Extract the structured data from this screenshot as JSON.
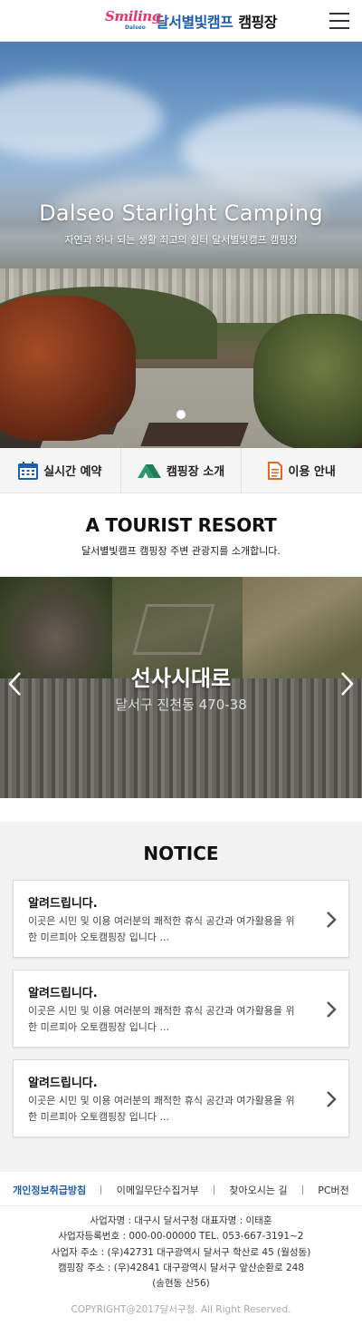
{
  "header": {
    "logo_smiling": "Smiling",
    "logo_dalseo": "Dalseo",
    "logo_main": "달서별빛캠프",
    "logo_sub": "캠핑장",
    "menu_icon": "hamburger-menu-icon"
  },
  "hero": {
    "title": "Dalseo Starlight Camping",
    "subtitle": "자연과 하나 되는 생활 최고의 쉼터 달서별빛캠프 캠핑장"
  },
  "quick_menu": [
    {
      "label": "실시간 예약",
      "icon": "calendar-icon",
      "color": "#1d5fae"
    },
    {
      "label": "캠핑장 소개",
      "icon": "tent-icon",
      "color": "#2a9a6e"
    },
    {
      "label": "이용 안내",
      "icon": "document-icon",
      "color": "#e0692a"
    }
  ],
  "tourist": {
    "title": "A TOURIST RESORT",
    "description": "달서별빛캠프 캠핑장 주변 관광지를 소개합니다.",
    "slide": {
      "name": "선사시대로",
      "address": "달서구 진천동 470-38"
    }
  },
  "notice": {
    "title": "NOTICE",
    "items": [
      {
        "title": "알려드립니다.",
        "body": "이곳은 시민 및 이용 여러분의 쾌적한 휴식 공간과 여가활용을 위한 미르피아 오토캠핑장 입니다 ..."
      },
      {
        "title": "알려드립니다.",
        "body": "이곳은 시민 및 이용 여러분의 쾌적한 휴식 공간과 여가활용을 위한 미르피아 오토캠핑장 입니다 ..."
      },
      {
        "title": "알려드립니다.",
        "body": "이곳은 시민 및 이용 여러분의 쾌적한 휴식 공간과 여가활용을 위한 미르피아 오토캠핑장 입니다 ..."
      }
    ]
  },
  "footer": {
    "links": [
      "개인정보취급방침",
      "이메일무단수집거부",
      "찾아오시는 길",
      "PC버전"
    ],
    "info": [
      "사업자명 : 대구시 달서구청 대표자명 : 이태훈",
      "사업자등록번호 : 000-00-00000 TEL. 053-667-3191~2",
      "사업자 주소 : (우)42731 대구광역시 달서구 학산로 45 (월성동)",
      "캠핑장 주소 : (우)42841 대구광역시 달서구 앞산순환로 248",
      "(송현동 산56)"
    ],
    "copyright": "COPYRIGHT@2017달서구청. All Right Reserved."
  }
}
